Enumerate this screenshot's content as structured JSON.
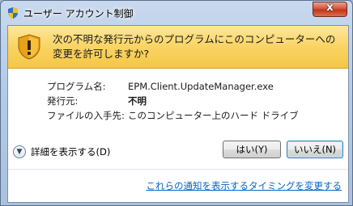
{
  "window": {
    "title": "ユーザー アカウント制御",
    "close_glyph": "x"
  },
  "banner": {
    "message": "次の不明な発行元からのプログラムにこのコンピューターへの変更を許可しますか?"
  },
  "details": {
    "program_label": "プログラム名:",
    "program_value": "EPM.Client.UpdateManager.exe",
    "publisher_label": "発行元:",
    "publisher_value": "不明",
    "origin_label": "ファイルの入手先:",
    "origin_value": "このコンピューター上のハード ドライブ"
  },
  "expander": {
    "label": "詳細を表示する(D)"
  },
  "buttons": {
    "yes": "はい(Y)",
    "no": "いいえ(N)"
  },
  "link": {
    "text": "これらの通知を表示するタイミングを変更する"
  },
  "colors": {
    "banner": "#f9d464",
    "link": "#0066cc",
    "close": "#c4341a"
  }
}
